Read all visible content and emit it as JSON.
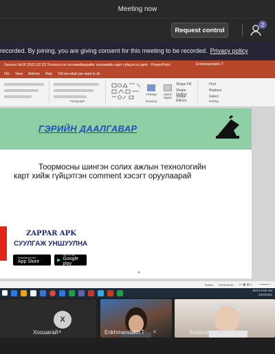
{
  "window": {
    "title": "Meeting now"
  },
  "toolbar": {
    "request_control": "Request control",
    "participants_count": "2",
    "people_icon": "people-icon"
  },
  "recording_banner": {
    "text": "recorded. By joining, you are giving consent for this meeting to be recorded.",
    "link": "Privacy policy"
  },
  "powerpoint": {
    "title_bar": "Хичээл №16 2021.02.23 Толгоостоо оптимайзерийн техникийн карт гүйцэтгэх.pptx - PowerPoint",
    "user": "Enkhmandakh.T",
    "menu": [
      "File",
      "View",
      "Add-ins",
      "Help",
      "Tell me what you want to do"
    ],
    "ribbon_groups": [
      "Paragraph",
      "Drawing",
      "Editing"
    ],
    "ribbon_items": [
      "Shape Fill",
      "Shape Outline",
      "Shape Effects",
      "Arrange",
      "Quick Styles",
      "Find",
      "Replace",
      "Select"
    ],
    "slide": {
      "heading": "ГЭРИЙН ДААЛГАВАР",
      "body": "Тоормосны шингэн солих ажлын технологийн карт хийж гүйцэтгэн comment хэсэгт оруулаарай",
      "zappar_title": "ZAPPAR APK",
      "zappar_sub": "СУУЛГАЖ УНШУУЛНА",
      "app_store": {
        "small": "Download on the",
        "big": "App Store"
      },
      "google_play": {
        "small": "GET IT ON",
        "big": "Google play"
      }
    },
    "status": {
      "notes": "Notes",
      "comments": "Comments"
    }
  },
  "taskbar": {
    "time": "8:09 AM",
    "date": "2/23/2021",
    "lang": "МОН",
    "icons": [
      "#2b78e4",
      "#e8a317",
      "#f1f1f1",
      "#3a73c9",
      "#d9473a",
      "#2b78e4",
      "#1e9e4a",
      "#6264a7",
      "#c0392b",
      "#3aa9e0",
      "#c43e1c",
      "#1e9e4a"
    ]
  },
  "participants": [
    {
      "name": "Хосшагай",
      "initial": "X",
      "muted": true
    },
    {
      "name": "Enkhmandakh.T",
      "initial": "",
      "muted": true
    },
    {
      "name": "Баяргаа",
      "initial": "",
      "muted": true
    }
  ],
  "colors": {
    "accent": "#6264a7",
    "ppt_red": "#b7472a",
    "slide_band": "#8fcfa6",
    "heading_blue": "#1a4fbf"
  }
}
